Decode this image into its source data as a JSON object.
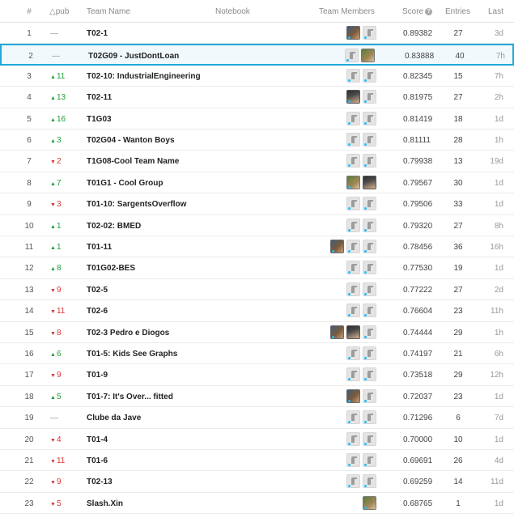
{
  "header": {
    "rank": "#",
    "delta": "△pub",
    "team": "Team Name",
    "notebook": "Notebook",
    "members": "Team Members",
    "score": "Score",
    "score_help_icon": "?",
    "entries": "Entries",
    "last": "Last"
  },
  "colors": {
    "highlight_border": "#20a8d8",
    "up": "#20a03a",
    "down": "#d93636"
  },
  "rows": [
    {
      "rank": "1",
      "delta": "—",
      "dir": "none",
      "team": "T02-1",
      "members": [
        "photo",
        "default"
      ],
      "score": "0.89382",
      "entries": "27",
      "last": "3d"
    },
    {
      "rank": "2",
      "delta": "—",
      "dir": "none",
      "team": "T02G09 - JustDontLoan",
      "members": [
        "default",
        "photo3"
      ],
      "score": "0.83888",
      "entries": "40",
      "last": "7h",
      "highlight": true
    },
    {
      "rank": "3",
      "delta": "11",
      "dir": "up",
      "team": "T02-10: IndustrialEngineering",
      "members": [
        "default",
        "default"
      ],
      "score": "0.82345",
      "entries": "15",
      "last": "7h"
    },
    {
      "rank": "4",
      "delta": "13",
      "dir": "up",
      "team": "T02-11",
      "members": [
        "photo2",
        "default"
      ],
      "score": "0.81975",
      "entries": "27",
      "last": "2h"
    },
    {
      "rank": "5",
      "delta": "16",
      "dir": "up",
      "team": "T1G03",
      "members": [
        "default",
        "default"
      ],
      "score": "0.81419",
      "entries": "18",
      "last": "1d"
    },
    {
      "rank": "6",
      "delta": "3",
      "dir": "up",
      "team": "T02G04 - Wanton Boys",
      "members": [
        "default",
        "default"
      ],
      "score": "0.81111",
      "entries": "28",
      "last": "1h"
    },
    {
      "rank": "7",
      "delta": "2",
      "dir": "down",
      "team": "T1G08-Cool Team Name",
      "members": [
        "default",
        "default"
      ],
      "score": "0.79938",
      "entries": "13",
      "last": "19d"
    },
    {
      "rank": "8",
      "delta": "7",
      "dir": "up",
      "team": "T01G1 - Cool Group",
      "members": [
        "photo3",
        "photo2"
      ],
      "score": "0.79567",
      "entries": "30",
      "last": "1d"
    },
    {
      "rank": "9",
      "delta": "3",
      "dir": "down",
      "team": "T01-10: SargentsOverflow",
      "members": [
        "default",
        "default"
      ],
      "score": "0.79506",
      "entries": "33",
      "last": "1d"
    },
    {
      "rank": "10",
      "delta": "1",
      "dir": "up",
      "team": "T02-02: BMED",
      "members": [
        "default",
        "default"
      ],
      "score": "0.79320",
      "entries": "27",
      "last": "8h"
    },
    {
      "rank": "11",
      "delta": "1",
      "dir": "up",
      "team": "T01-11",
      "members": [
        "photo",
        "default",
        "default"
      ],
      "score": "0.78456",
      "entries": "36",
      "last": "16h"
    },
    {
      "rank": "12",
      "delta": "8",
      "dir": "up",
      "team": "T01G02-BES",
      "members": [
        "default",
        "default"
      ],
      "score": "0.77530",
      "entries": "19",
      "last": "1d"
    },
    {
      "rank": "13",
      "delta": "9",
      "dir": "down",
      "team": "T02-5",
      "members": [
        "default",
        "default"
      ],
      "score": "0.77222",
      "entries": "27",
      "last": "2d"
    },
    {
      "rank": "14",
      "delta": "11",
      "dir": "down",
      "team": "T02-6",
      "members": [
        "default",
        "default"
      ],
      "score": "0.76604",
      "entries": "23",
      "last": "11h"
    },
    {
      "rank": "15",
      "delta": "8",
      "dir": "down",
      "team": "T02-3 Pedro e Diogos",
      "members": [
        "photo",
        "photo2",
        "default"
      ],
      "score": "0.74444",
      "entries": "29",
      "last": "1h"
    },
    {
      "rank": "16",
      "delta": "6",
      "dir": "up",
      "team": "T01-5: Kids See Graphs",
      "members": [
        "default",
        "default"
      ],
      "score": "0.74197",
      "entries": "21",
      "last": "6h"
    },
    {
      "rank": "17",
      "delta": "9",
      "dir": "down",
      "team": "T01-9",
      "members": [
        "default",
        "default"
      ],
      "score": "0.73518",
      "entries": "29",
      "last": "12h"
    },
    {
      "rank": "18",
      "delta": "5",
      "dir": "up",
      "team": "T01-7: It's Over... fitted",
      "members": [
        "photo",
        "default"
      ],
      "score": "0.72037",
      "entries": "23",
      "last": "1d"
    },
    {
      "rank": "19",
      "delta": "—",
      "dir": "none",
      "team": "Clube da Jave",
      "members": [
        "default",
        "default"
      ],
      "score": "0.71296",
      "entries": "6",
      "last": "7d"
    },
    {
      "rank": "20",
      "delta": "4",
      "dir": "down",
      "team": "T01-4",
      "members": [
        "default",
        "default"
      ],
      "score": "0.70000",
      "entries": "10",
      "last": "1d"
    },
    {
      "rank": "21",
      "delta": "11",
      "dir": "down",
      "team": "T01-6",
      "members": [
        "default",
        "default"
      ],
      "score": "0.69691",
      "entries": "26",
      "last": "4d"
    },
    {
      "rank": "22",
      "delta": "9",
      "dir": "down",
      "team": "T02-13",
      "members": [
        "default",
        "default"
      ],
      "score": "0.69259",
      "entries": "14",
      "last": "11d"
    },
    {
      "rank": "23",
      "delta": "5",
      "dir": "down",
      "team": "Slash.Xin",
      "members": [
        "photo3"
      ],
      "score": "0.68765",
      "entries": "1",
      "last": "1d"
    }
  ]
}
